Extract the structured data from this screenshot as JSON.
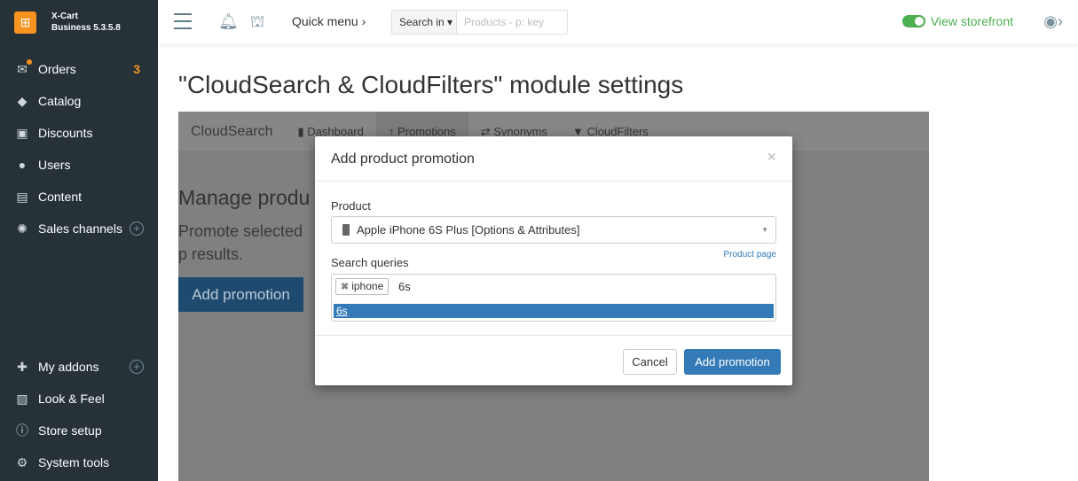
{
  "brand": {
    "name": "X-Cart",
    "edition": "Business 5.3.5.8"
  },
  "sidebar": {
    "items": [
      {
        "label": "Orders",
        "badge": "3"
      },
      {
        "label": "Catalog"
      },
      {
        "label": "Discounts"
      },
      {
        "label": "Users"
      },
      {
        "label": "Content"
      },
      {
        "label": "Sales channels"
      },
      {
        "label": "My addons"
      },
      {
        "label": "Look & Feel"
      },
      {
        "label": "Store setup"
      },
      {
        "label": "System tools"
      }
    ]
  },
  "header": {
    "quick_menu": "Quick menu ›",
    "search_in": "Search in",
    "search_placeholder": "Products - p: key",
    "view_storefront": "View storefront"
  },
  "page": {
    "title": "\"CloudSearch & CloudFilters\" module settings",
    "tabs": {
      "title": "CloudSearch",
      "dashboard": "Dashboard",
      "promotions": "Promotions",
      "synonyms": "Synonyms",
      "cloudfilters": "CloudFilters"
    },
    "heading": "Manage produ",
    "description": "Promote selected p results.",
    "add_button": "Add promotion"
  },
  "modal": {
    "title": "Add product promotion",
    "product_label": "Product",
    "product_value": "Apple iPhone 6S Plus [Options & Attributes]",
    "product_page": "Product page",
    "queries_label": "Search queries",
    "tag": "iphone",
    "typed": "6s",
    "suggestion": "6s",
    "cancel": "Cancel",
    "submit": "Add promotion"
  }
}
